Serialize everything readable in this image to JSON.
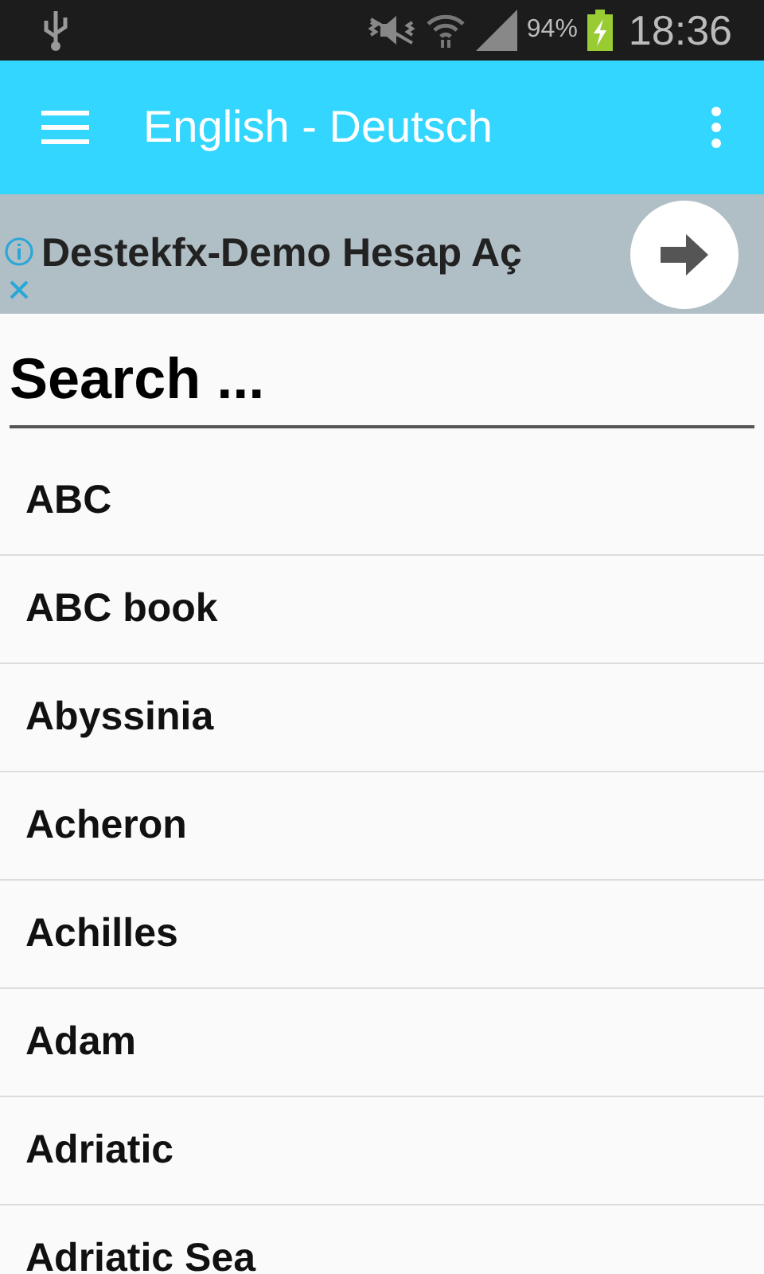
{
  "status_bar": {
    "battery": "94%",
    "time": "18:36"
  },
  "app_bar": {
    "title": "English - Deutsch"
  },
  "ad": {
    "text": "Destekfx-Demo Hesap Aç"
  },
  "search": {
    "placeholder": "Search ..."
  },
  "words": [
    "ABC",
    "ABC book",
    "Abyssinia",
    "Acheron",
    "Achilles",
    "Adam",
    "Adriatic",
    "Adriatic Sea"
  ]
}
